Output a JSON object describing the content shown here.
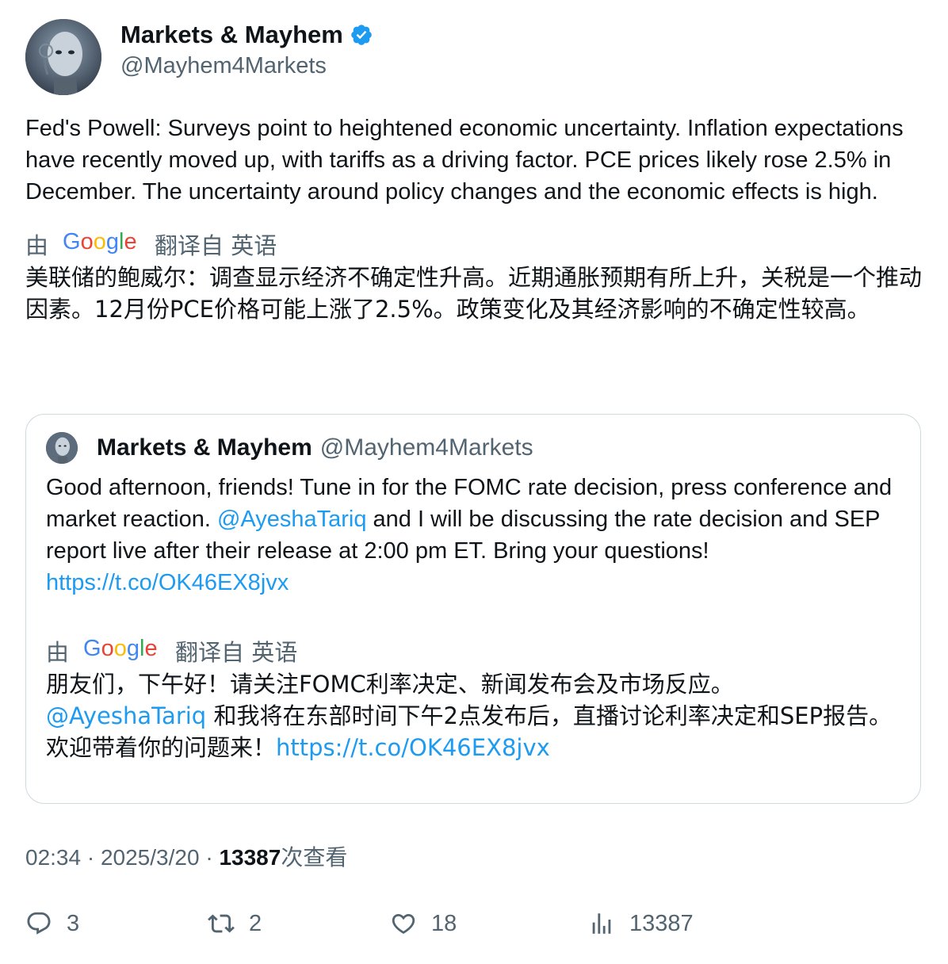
{
  "tweet": {
    "display_name": "Markets & Mayhem",
    "handle": "@Mayhem4Markets",
    "text": "Fed's Powell: Surveys point to heightened economic uncertainty. Inflation expectations have recently moved up, with tariffs as a driving factor. PCE prices likely rose 2.5% in December. The uncertainty around policy changes and the economic effects is high.",
    "translation": {
      "prefix": "由",
      "provider": "Google",
      "suffix": "翻译自 英语",
      "text": "美联储的鲍威尔：调查显示经济不确定性升高。近期通胀预期有所上升，关税是一个推动因素。12月份PCE价格可能上涨了2.5%。政策变化及其经济影响的不确定性较高。"
    }
  },
  "quote": {
    "display_name": "Markets & Mayhem",
    "handle": "@Mayhem4Markets",
    "text_part1": "Good afternoon, friends! Tune in for the FOMC rate decision, press conference and market reaction.",
    "mention": "@AyeshaTariq",
    "text_part2": "and I will be discussing the rate decision and SEP report live after their release at 2:00 pm ET. Bring your questions!",
    "link": "https://t.co/OK46EX8jvx",
    "translation": {
      "prefix": "由",
      "provider": "Google",
      "suffix": "翻译自 英语",
      "line1": "朋友们，下午好！请关注FOMC利率决定、新闻发布会及市场反应。",
      "mention": "@AyeshaTariq",
      "text": "和我将在东部时间下午2点发布后，直播讨论利率决定和SEP报告。欢迎带着你的问题来！",
      "link": "https://t.co/OK46EX8jvx"
    }
  },
  "meta": {
    "time": "02:34",
    "sep": "·",
    "date": "2025/3/20",
    "views_count": "13387",
    "views_label": "次查看"
  },
  "actions": {
    "replies": "3",
    "retweets": "2",
    "likes": "18",
    "views": "13387"
  },
  "colors": {
    "link": "#1d9bf0",
    "secondary": "#536471",
    "verified": "#1d9bf0",
    "border": "#cfd9de"
  }
}
